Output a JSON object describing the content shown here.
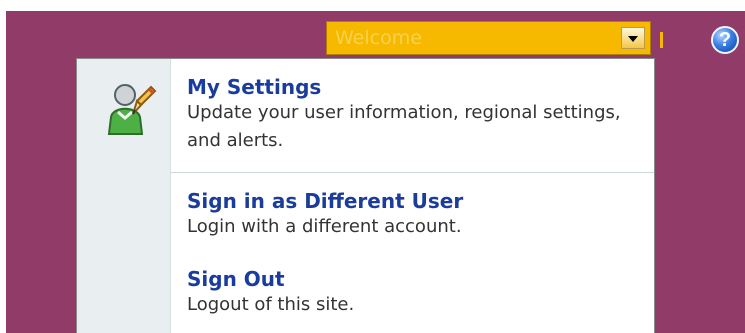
{
  "header": {
    "welcome_menu": {
      "label": "Welcome",
      "icon": "chevron-down-icon"
    },
    "help_icon": "?"
  },
  "menu": {
    "items": [
      {
        "title": "My Settings",
        "description": "Update your user information, regional settings, and alerts.",
        "icon": "user-edit-icon"
      },
      {
        "title": "Sign in as Different User",
        "description": "Login with a different account."
      },
      {
        "title": "Sign Out",
        "description": "Logout of this site."
      }
    ]
  },
  "colors": {
    "header_background": "#903b68",
    "welcome_menu_background": "#f7b800",
    "menu_link_color": "#1a3c9c",
    "menu_gutter_background": "#e9eef0"
  }
}
